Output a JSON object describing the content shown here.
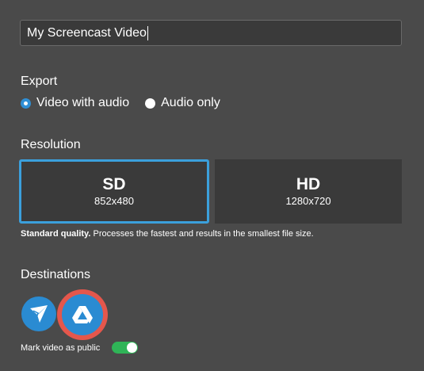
{
  "title_field": {
    "value": "My Screencast Video"
  },
  "export": {
    "label": "Export",
    "options": [
      {
        "label": "Video with audio",
        "selected": true
      },
      {
        "label": "Audio only",
        "selected": false
      }
    ]
  },
  "resolution": {
    "label": "Resolution",
    "options": [
      {
        "name": "SD",
        "dims": "852x480",
        "selected": true
      },
      {
        "name": "HD",
        "dims": "1280x720",
        "selected": false
      }
    ],
    "note_bold": "Standard quality.",
    "note_rest": " Processes the fastest and results in the smallest file size."
  },
  "destinations": {
    "label": "Destinations",
    "items": [
      {
        "icon": "screencast-o-matic-icon"
      },
      {
        "icon": "google-drive-icon",
        "highlighted": true
      }
    ]
  },
  "public_toggle": {
    "label": "Mark video as public",
    "on": true
  },
  "colors": {
    "background": "#4a4a4a",
    "accent": "#3ba0dc",
    "highlight_ring": "#e4574c",
    "toggle_on": "#2fb457"
  }
}
